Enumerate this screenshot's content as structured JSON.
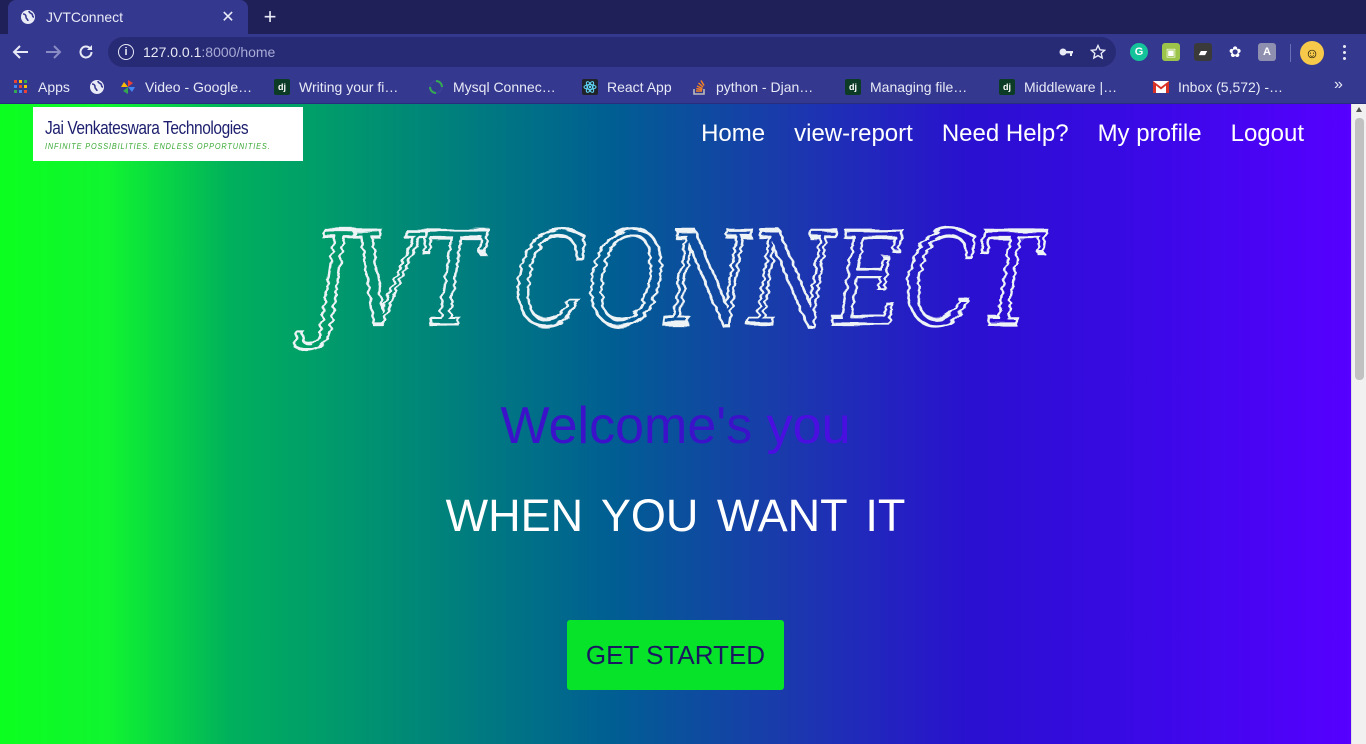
{
  "browser": {
    "tab": {
      "title": "JVTConnect",
      "close_glyph": "✕"
    },
    "new_tab_glyph": "+",
    "address": {
      "host": "127.0.0.1",
      "path": ":8000/home"
    },
    "bookmarks_overflow": "»",
    "bookmarks": [
      {
        "label": "Apps",
        "icon": "apps-grid-icon"
      },
      {
        "label": "",
        "icon": "globe-icon"
      },
      {
        "label": "Video - Google…",
        "icon": "google-pinwheel-icon"
      },
      {
        "label": "Writing your fi…",
        "icon": "django-icon"
      },
      {
        "label": "Mysql Connec…",
        "icon": "loading-ring-icon"
      },
      {
        "label": "React App",
        "icon": "react-icon"
      },
      {
        "label": "python - Djan…",
        "icon": "stackoverflow-icon"
      },
      {
        "label": "Managing file…",
        "icon": "django-icon"
      },
      {
        "label": "Middleware |…",
        "icon": "django-icon"
      },
      {
        "label": "Inbox (5,572) -…",
        "icon": "gmail-icon"
      }
    ]
  },
  "site": {
    "logo": {
      "title": "Jai Venkateswara Technologies",
      "tagline": "INFINITE POSSIBILITIES. ENDLESS OPPORTUNITIES."
    },
    "nav": [
      {
        "label": "Home"
      },
      {
        "label": "view-report"
      },
      {
        "label": "Need Help?"
      },
      {
        "label": "My profile"
      },
      {
        "label": "Logout"
      }
    ],
    "hero_title": "JVT CONNECT",
    "welcome_main": "Welcome's",
    "welcome_tail": "you",
    "tagline": "WHEN YOU WANT IT",
    "cta_label": "GET STARTED"
  },
  "colors": {
    "accent_green": "#06e329",
    "accent_purple": "#5600ff",
    "chrome_bg": "#35388f"
  }
}
